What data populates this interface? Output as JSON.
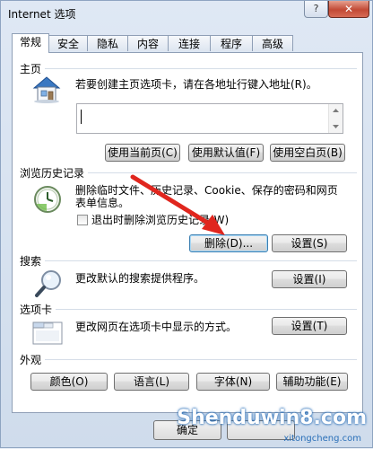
{
  "window": {
    "title": "Internet 选项",
    "help_label": "?",
    "close_label": "✕"
  },
  "tabs": [
    {
      "label": "常规",
      "active": true
    },
    {
      "label": "安全"
    },
    {
      "label": "隐私"
    },
    {
      "label": "内容"
    },
    {
      "label": "连接"
    },
    {
      "label": "程序"
    },
    {
      "label": "高级"
    }
  ],
  "home": {
    "section_title": "主页",
    "description": "若要创建主页选项卡，请在各地址行键入地址(R)。",
    "url_value": "",
    "buttons": {
      "current": "使用当前页(C)",
      "default": "使用默认值(F)",
      "blank": "使用空白页(B)"
    }
  },
  "history": {
    "section_title": "浏览历史记录",
    "description_line1": "删除临时文件、历史记录、Cookie、保存的密码和网页",
    "description_line2": "表单信息。",
    "checkbox_label": "退出时删除浏览历史记录(W)",
    "checkbox_checked": false,
    "buttons": {
      "delete": "删除(D)...",
      "settings": "设置(S)"
    }
  },
  "search": {
    "section_title": "搜索",
    "description": "更改默认的搜索提供程序。",
    "settings_label": "设置(I)"
  },
  "tabs_section": {
    "section_title": "选项卡",
    "description": "更改网页在选项卡中显示的方式。",
    "settings_label": "设置(T)"
  },
  "appearance": {
    "section_title": "外观",
    "buttons": {
      "colors": "颜色(O)",
      "languages": "语言(L)",
      "fonts": "字体(N)",
      "accessibility": "辅助功能(E)"
    }
  },
  "footer": {
    "ok_label": "确定"
  },
  "watermark": {
    "brand": "Shenduwin8.com",
    "url": "xitongcheng.com"
  },
  "colors": {
    "arrow": "#e0261e",
    "accent": "#3c7fb1"
  }
}
